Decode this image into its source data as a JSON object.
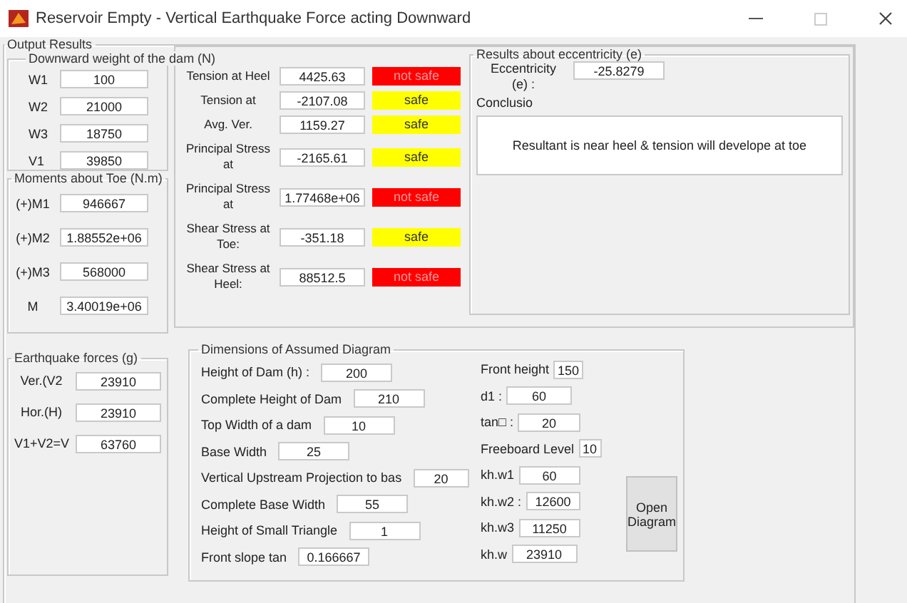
{
  "window": {
    "title": "Reservoir Empty - Vertical Earthquake Force acting Downward"
  },
  "output_results": {
    "title": "Output Results",
    "weights": {
      "title": "Downward weight of the dam (N)",
      "fields": [
        {
          "label": "W1",
          "value": "100"
        },
        {
          "label": "W2",
          "value": "21000"
        },
        {
          "label": "W3",
          "value": "18750"
        },
        {
          "label": "V1",
          "value": "39850"
        }
      ]
    },
    "moments": {
      "title": "Moments about Toe (N.m)",
      "fields": [
        {
          "label": "(+)M1",
          "value": "946667"
        },
        {
          "label": "(+)M2",
          "value": "1.88552e+06"
        },
        {
          "label": "(+)M3",
          "value": "568000"
        },
        {
          "label": "M",
          "value": "3.40019e+06"
        }
      ]
    },
    "earthquake": {
      "title": "Earthquake forces (g)",
      "fields": [
        {
          "label": "Ver.(V2",
          "value": "23910"
        },
        {
          "label": "Hor.(H)",
          "value": "23910"
        },
        {
          "label": "V1+V2=V",
          "value": "63760"
        }
      ]
    },
    "stresses": [
      {
        "label": "Tension at Heel",
        "value": "4425.63",
        "status": "not safe",
        "safe": false
      },
      {
        "label": "Tension at",
        "value": "-2107.08",
        "status": "safe",
        "safe": true
      },
      {
        "label": "Avg. Ver.",
        "value": "1159.27",
        "status": "safe",
        "safe": true
      },
      {
        "label": "Principal Stress at",
        "value": "-2165.61",
        "status": "safe",
        "safe": true
      },
      {
        "label": "Principal Stress at",
        "value": "1.77468e+06",
        "status": "not safe",
        "safe": false
      },
      {
        "label": "Shear Stress at Toe:",
        "value": "-351.18",
        "status": "safe",
        "safe": true
      },
      {
        "label": "Shear Stress at Heel:",
        "value": "88512.5",
        "status": "not safe",
        "safe": false
      }
    ],
    "eccentricity": {
      "title": "Results about eccentricity (e)",
      "label": "Eccentricity (e) :",
      "value": "-25.8279",
      "conclusion_label": "Conclusio",
      "conclusion": "Resultant is near heel & tension will develope at toe"
    },
    "dimensions": {
      "title": "Dimensions of Assumed Diagram",
      "left": [
        {
          "label": "Height of Dam (h) :",
          "value": "200"
        },
        {
          "label": "Complete Height of Dam",
          "value": "210"
        },
        {
          "label": "Top Width of a dam",
          "value": "10"
        },
        {
          "label": "Base Width",
          "value": "25"
        },
        {
          "label": "Vertical Upstream Projection to bas",
          "value": "20"
        },
        {
          "label": "Complete Base Width",
          "value": "55"
        },
        {
          "label": "Height of Small Triangle",
          "value": "1"
        },
        {
          "label": "Front slope tan",
          "value": "0.166667"
        }
      ],
      "right": [
        {
          "label": "Front height",
          "value": "150"
        },
        {
          "label": "d1 :",
          "value": "60"
        },
        {
          "label": "tan□ :",
          "value": "20"
        },
        {
          "label": "Freeboard Level",
          "value": "10"
        },
        {
          "label": "kh.w1",
          "value": "60"
        },
        {
          "label": "kh.w2 :",
          "value": "12600"
        },
        {
          "label": "kh.w3",
          "value": "11250"
        },
        {
          "label": "kh.w",
          "value": "23910"
        }
      ],
      "button": "Open Diagram"
    }
  }
}
